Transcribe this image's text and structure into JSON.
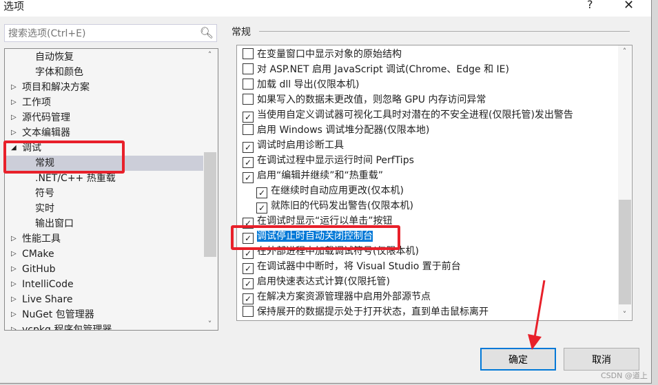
{
  "window": {
    "title": "选项",
    "help": "?",
    "close": "✕"
  },
  "search": {
    "placeholder": "搜索选项(Ctrl+E)"
  },
  "tree": [
    {
      "label": "自动恢复",
      "level": 1
    },
    {
      "label": "字体和颜色",
      "level": 1
    },
    {
      "label": "项目和解决方案",
      "level": 0,
      "state": "collapsed"
    },
    {
      "label": "工作项",
      "level": 0,
      "state": "collapsed"
    },
    {
      "label": "源代码管理",
      "level": 0,
      "state": "collapsed"
    },
    {
      "label": "文本编辑器",
      "level": 0,
      "state": "collapsed"
    },
    {
      "label": "调试",
      "level": 0,
      "state": "expanded"
    },
    {
      "label": "常规",
      "level": 1,
      "selected": true
    },
    {
      "label": ".NET/C++ 热重载",
      "level": 1
    },
    {
      "label": "符号",
      "level": 1
    },
    {
      "label": "实时",
      "level": 1
    },
    {
      "label": "输出窗口",
      "level": 1
    },
    {
      "label": "性能工具",
      "level": 0,
      "state": "collapsed"
    },
    {
      "label": "CMake",
      "level": 0,
      "state": "collapsed"
    },
    {
      "label": "GitHub",
      "level": 0,
      "state": "collapsed"
    },
    {
      "label": "IntelliCode",
      "level": 0,
      "state": "collapsed"
    },
    {
      "label": "Live Share",
      "level": 0,
      "state": "collapsed"
    },
    {
      "label": "NuGet 包管理器",
      "level": 0,
      "state": "collapsed"
    },
    {
      "label": "vcpkg 程序包管理器",
      "level": 0,
      "state": "collapsed"
    }
  ],
  "section_title": "常规",
  "options": [
    {
      "label": "在变量窗口中显示对象的原始结构",
      "checked": false,
      "level": 0
    },
    {
      "label": "对 ASP.NET 启用 JavaScript 调试(Chrome、Edge 和 IE)",
      "checked": false,
      "level": 0
    },
    {
      "label": "加载 dll 导出(仅限本机)",
      "checked": false,
      "level": 0
    },
    {
      "label": "如果写入的数据未更改值，则忽略 GPU 内存访问异常",
      "checked": false,
      "level": 0
    },
    {
      "label": "当使用自定义调试器可视化工具时对潜在的不安全进程(仅限托管)发出警告",
      "checked": true,
      "level": 0
    },
    {
      "label": "启用 Windows 调试堆分配器(仅限本地)",
      "checked": false,
      "level": 0
    },
    {
      "label": "调试时启用诊断工具",
      "checked": true,
      "level": 0
    },
    {
      "label": "在调试过程中显示运行时间 PerfTips",
      "checked": true,
      "level": 0
    },
    {
      "label": "启用“编辑并继续”和“热重载”",
      "checked": true,
      "level": 0
    },
    {
      "label": "在继续时自动应用更改(仅本机)",
      "checked": true,
      "level": 1
    },
    {
      "label": "就陈旧的代码发出警告(仅限本机)",
      "checked": true,
      "level": 1
    },
    {
      "label": "在调试时显示“运行以单击”按钮",
      "checked": true,
      "level": 0
    },
    {
      "label": "调试停止时自动关闭控制台",
      "checked": true,
      "level": 0,
      "highlighted": true
    },
    {
      "label": "在外部进程中加载调试符号(仅限本机)",
      "checked": true,
      "level": 0
    },
    {
      "label": "在调试器中中断时，将 Visual Studio 置于前台",
      "checked": true,
      "level": 0
    },
    {
      "label": "启用快速表达式计算(仅限托管)",
      "checked": true,
      "level": 0
    },
    {
      "label": "在解决方案资源管理器中启用外部源节点",
      "checked": true,
      "level": 0
    },
    {
      "label": "保持展开的数据提示处于打开状态，直到单击鼠标离开",
      "checked": false,
      "level": 0
    }
  ],
  "buttons": {
    "ok": "确定",
    "cancel": "取消"
  },
  "watermark": "CSDN @道上",
  "colors": {
    "annotation": "#e8202a",
    "selection": "#0078d7"
  }
}
